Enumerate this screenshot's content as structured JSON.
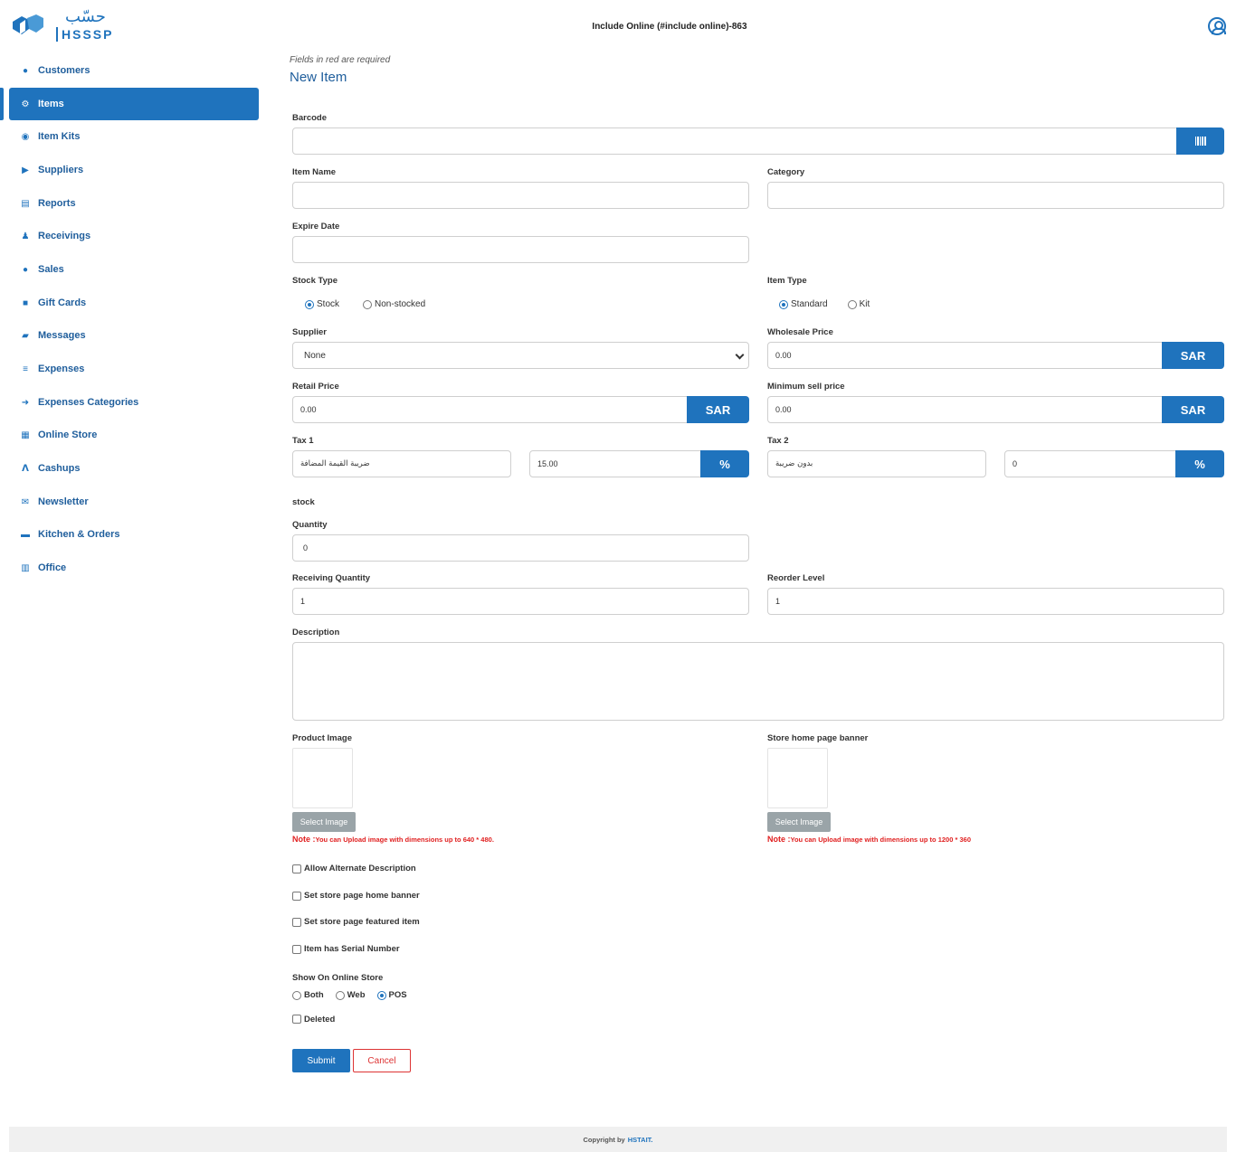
{
  "app": {
    "logo_ar": "حسّب",
    "logo_en": "HSSSP",
    "header_title": "Include Online (#include online)-863"
  },
  "sidebar": {
    "items": [
      {
        "label": "Customers",
        "icon": "users-icon"
      },
      {
        "label": "Items",
        "icon": "box-icon",
        "active": true
      },
      {
        "label": "Item Kits",
        "icon": "kit-icon"
      },
      {
        "label": "Suppliers",
        "icon": "truck-icon"
      },
      {
        "label": "Reports",
        "icon": "chart-icon"
      },
      {
        "label": "Receivings",
        "icon": "receive-icon"
      },
      {
        "label": "Sales",
        "icon": "sales-icon"
      },
      {
        "label": "Gift Cards",
        "icon": "gift-icon"
      },
      {
        "label": "Messages",
        "icon": "message-icon"
      },
      {
        "label": "Expenses",
        "icon": "money-icon"
      },
      {
        "label": "Expenses Categories",
        "icon": "category-icon"
      },
      {
        "label": "Online Store",
        "icon": "store-icon"
      },
      {
        "label": "Cashups",
        "icon": "cashup-icon"
      },
      {
        "label": "Newsletter",
        "icon": "newsletter-icon"
      },
      {
        "label": "Kitchen & Orders",
        "icon": "kitchen-icon"
      },
      {
        "label": "Office",
        "icon": "office-icon"
      }
    ]
  },
  "form": {
    "required_note": "Fields in red are required",
    "title": "New Item",
    "barcode": {
      "label": "Barcode",
      "value": ""
    },
    "item_name": {
      "label": "Item Name",
      "value": ""
    },
    "category": {
      "label": "Category",
      "value": ""
    },
    "expire_date": {
      "label": "Expire Date",
      "value": ""
    },
    "stock_type": {
      "label": "Stock Type",
      "options": [
        "Stock",
        "Non-stocked"
      ],
      "selected": "Stock"
    },
    "item_type": {
      "label": "Item Type",
      "options": [
        "Standard",
        "Kit"
      ],
      "selected": "Standard"
    },
    "supplier": {
      "label": "Supplier",
      "value": "None"
    },
    "wholesale_price": {
      "label": "Wholesale Price",
      "value": "0.00",
      "currency": "SAR"
    },
    "retail_price": {
      "label": "Retail Price",
      "value": "0.00",
      "currency": "SAR"
    },
    "min_sell_price": {
      "label": "Minimum sell price",
      "value": "0.00",
      "currency": "SAR"
    },
    "tax1": {
      "label": "Tax 1",
      "name": "ضريبة القيمة المضافة",
      "percent": "15.00",
      "symbol": "%"
    },
    "tax2": {
      "label": "Tax 2",
      "name": "بدون ضريبة",
      "percent": "0",
      "symbol": "%"
    },
    "stock_section": "stock",
    "quantity": {
      "label": "Quantity",
      "value": "0"
    },
    "receiving_quantity": {
      "label": "Receiving Quantity",
      "value": "1"
    },
    "reorder_level": {
      "label": "Reorder Level",
      "value": "1"
    },
    "description": {
      "label": "Description",
      "value": ""
    },
    "product_image": {
      "label": "Product Image",
      "button": "Select Image",
      "note_prefix": "Note :",
      "note": "You can Upload image with dimensions up to 640 * 480."
    },
    "banner_image": {
      "label": "Store home page banner",
      "button": "Select Image",
      "note_prefix": "Note :",
      "note": "You can Upload image with dimensions up to 1200 * 360"
    },
    "checkboxes": [
      "Allow Alternate Description",
      "Set store page home banner",
      "Set store page featured item",
      "Item has Serial Number"
    ],
    "show_online": {
      "label": "Show On Online Store",
      "options": [
        "Both",
        "Web",
        "POS"
      ],
      "selected": "POS"
    },
    "deleted_label": "Deleted",
    "submit_label": "Submit",
    "cancel_label": "Cancel"
  },
  "footer": {
    "text": "Copyright by",
    "brand": "HSTAIT."
  },
  "colors": {
    "primary": "#1f73bd",
    "danger": "#e02020"
  }
}
